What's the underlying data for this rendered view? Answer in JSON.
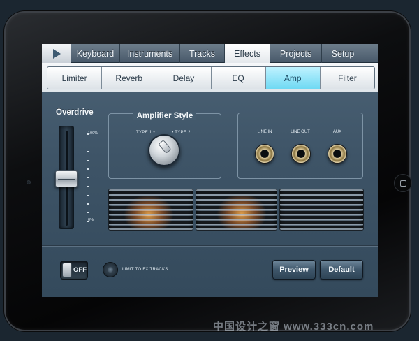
{
  "top_tabs": {
    "play_icon": "play-icon",
    "items": [
      {
        "label": "Keyboard",
        "active": false
      },
      {
        "label": "Instruments",
        "active": false
      },
      {
        "label": "Tracks",
        "active": false
      },
      {
        "label": "Effects",
        "active": true
      },
      {
        "label": "Projects",
        "active": false
      },
      {
        "label": "Setup",
        "active": false
      }
    ]
  },
  "sub_tabs": {
    "items": [
      {
        "label": "Limiter",
        "active": false
      },
      {
        "label": "Reverb",
        "active": false
      },
      {
        "label": "Delay",
        "active": false
      },
      {
        "label": "EQ",
        "active": false
      },
      {
        "label": "Amp",
        "active": true
      },
      {
        "label": "Filter",
        "active": false
      }
    ]
  },
  "overdrive": {
    "title": "Overdrive",
    "max_label": "100%",
    "min_label": "0%",
    "value_fraction": 0.48
  },
  "amplifier_style": {
    "title": "Amplifier Style",
    "type1_label": "TYPE 1 •",
    "type2_label": "• TYPE 2"
  },
  "jacks": {
    "line_in": "LINE IN",
    "line_out": "LINE OUT",
    "aux": "AUX"
  },
  "bottom": {
    "toggle_label": "OFF",
    "limit_label": "LIMIT TO FX TRACKS",
    "preview_label": "Preview",
    "default_label": "Default"
  },
  "watermark": "中国设计之窗 www.333cn.com",
  "colors": {
    "active_sub_tab": "#6fd9f3",
    "screen_bg": "#3e5467",
    "amp_glow": "#e6a040"
  }
}
